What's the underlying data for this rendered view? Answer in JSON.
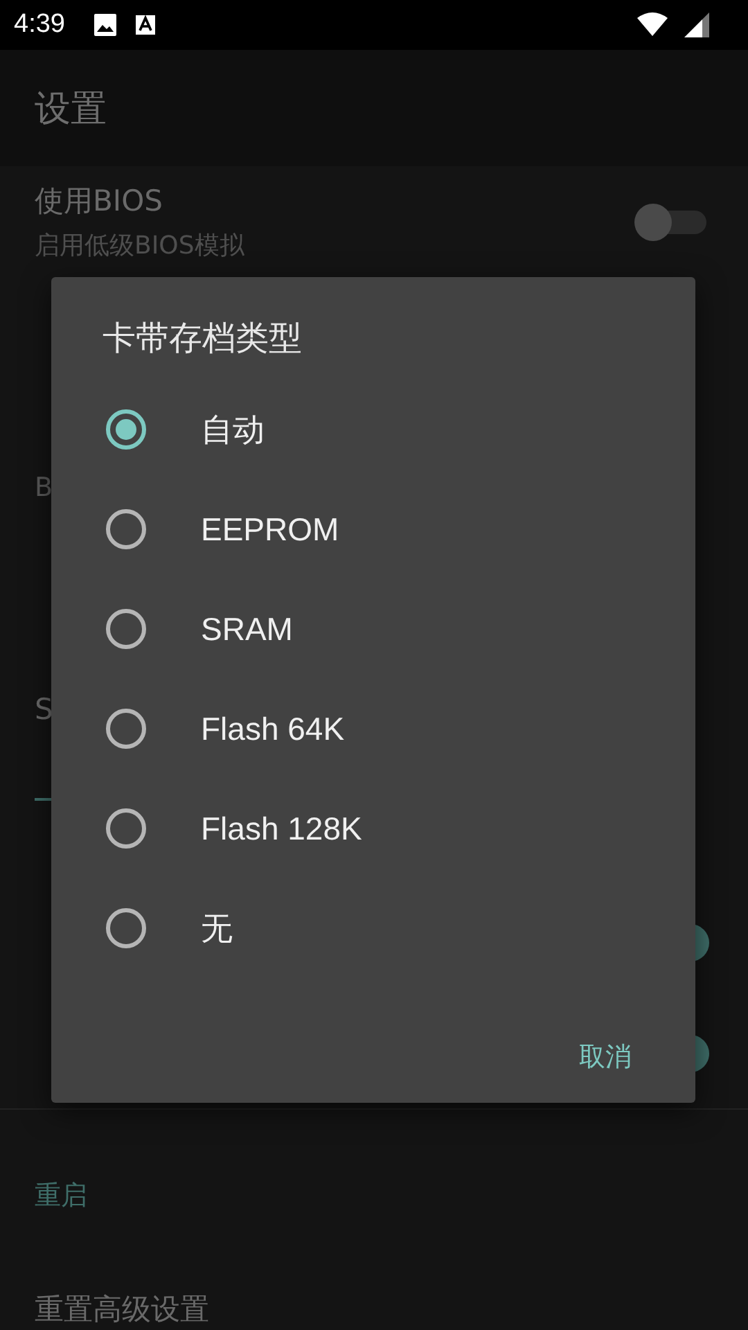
{
  "status_bar": {
    "time": "4:39"
  },
  "app_bar": {
    "title": "设置"
  },
  "settings": [
    {
      "kind": "switch",
      "title": "使用BIOS",
      "summary": "启用低级BIOS模拟",
      "on": false
    },
    {
      "kind": "text"
    },
    {
      "kind": "header",
      "title": "B"
    },
    {
      "kind": "single"
    },
    {
      "kind": "slider",
      "title": "S"
    },
    {
      "kind": "switch",
      "on": true
    },
    {
      "kind": "switch",
      "on": true
    },
    {
      "kind": "divider"
    },
    {
      "kind": "section",
      "title": "重启"
    },
    {
      "kind": "single",
      "title": "重置高级设置"
    }
  ],
  "dialog": {
    "title": "卡带存档类型",
    "options": [
      {
        "label": "自动",
        "selected": true
      },
      {
        "label": "EEPROM",
        "selected": false
      },
      {
        "label": "SRAM",
        "selected": false
      },
      {
        "label": "Flash 64K",
        "selected": false
      },
      {
        "label": "Flash 128K",
        "selected": false
      },
      {
        "label": "无",
        "selected": false
      }
    ],
    "cancel": "取消"
  }
}
